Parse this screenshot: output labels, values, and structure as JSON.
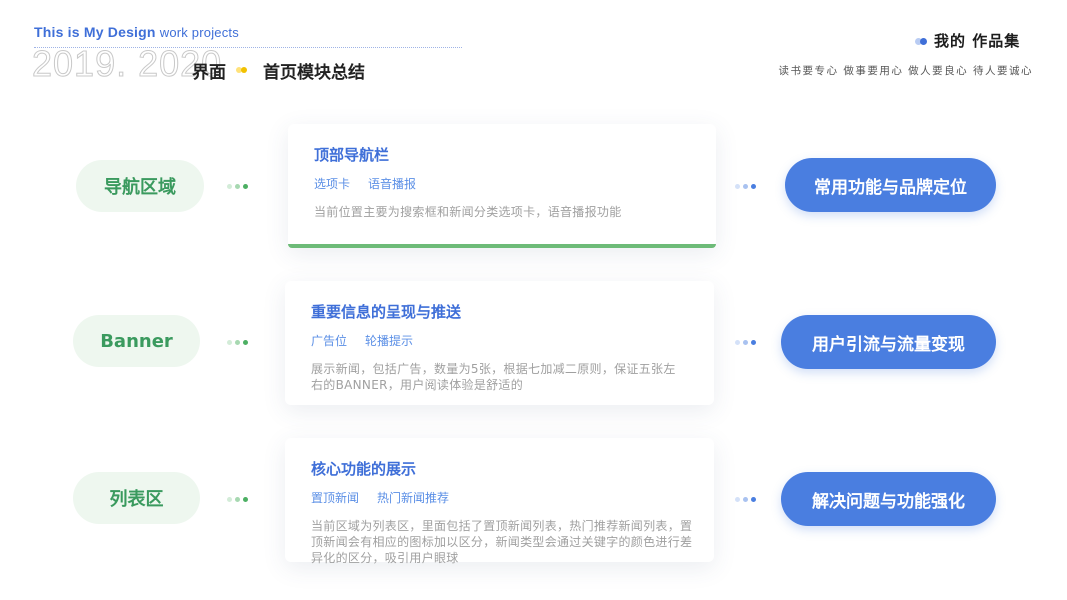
{
  "header": {
    "title_en": "This is My Design",
    "title_en_sub": "work projects",
    "years": "2019. 2020",
    "category": "界面",
    "topic": "首页模块总结",
    "brand": "我的 作品集",
    "motto": "读书要专心  做事要用心  做人要良心  待人要诚心",
    "accent_color": "#3f6fd8"
  },
  "rows": [
    {
      "label": "导航区域",
      "card": {
        "title": "顶部导航栏",
        "tags": [
          "选项卡",
          "语音播报"
        ],
        "desc": "当前位置主要为搜索框和新闻分类选项卡，语音播报功能"
      },
      "goal": "常用功能与品牌定位"
    },
    {
      "label": "Banner",
      "card": {
        "title": "重要信息的呈现与推送",
        "tags": [
          "广告位",
          "轮播提示"
        ],
        "desc": "展示新闻，包括广告，数量为5张，根据七加减二原则，保证五张左右的BANNER，用户阅读体验是舒适的"
      },
      "goal": "用户引流与流量变现"
    },
    {
      "label": "列表区",
      "card": {
        "title": "核心功能的展示",
        "tags": [
          "置顶新闻",
          "热门新闻推荐"
        ],
        "desc": "当前区域为列表区，里面包括了置顶新闻列表，热门推荐新闻列表，置顶新闻会有相应的图标加以区分，新闻类型会通过关键字的颜色进行差异化的区分，吸引用户眼球"
      },
      "goal": "解决问题与功能强化"
    }
  ],
  "colors": {
    "pill_bg": "#eef7ef",
    "pill_text": "#3a9a5e",
    "goal_bg": "#4a7ee0",
    "card_accent_bar": "#6dbb78"
  }
}
